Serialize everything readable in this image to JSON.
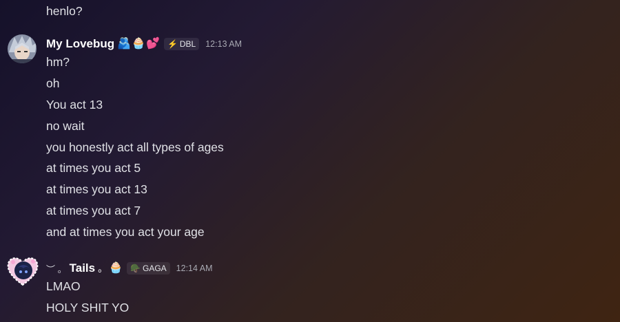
{
  "messages_top": {
    "line": "henlo?"
  },
  "group1": {
    "author": "My Lovebug",
    "emojis": [
      "🫂",
      "🧁",
      "💕"
    ],
    "tag_icon": "⚡",
    "tag": "DBL",
    "time": "12:13 AM",
    "lines": [
      "hm?",
      "oh",
      "You act 13",
      "no wait",
      "you honestly act all types of ages",
      "at times you act 5",
      "at times you act 13",
      "at times you act 7",
      "and at times you act your age"
    ]
  },
  "group2": {
    "name_prefix": "︶   。",
    "author": "Tails",
    "name_suffix": "。",
    "emoji": "🧁",
    "tag_icon": "🪖",
    "tag": "GAGA",
    "time": "12:14 AM",
    "lines": [
      "LMAO",
      "HOLY SHIT YO"
    ]
  },
  "icons": {
    "avatar1": "anime-avatar-icon",
    "avatar2": "heart-frame-avatar-icon"
  },
  "colors": {
    "bg_start": "#15112a",
    "bg_end": "#3f2412",
    "name": "#ffffff",
    "text": "#dfe0e5",
    "time": "#a8a9b2"
  }
}
